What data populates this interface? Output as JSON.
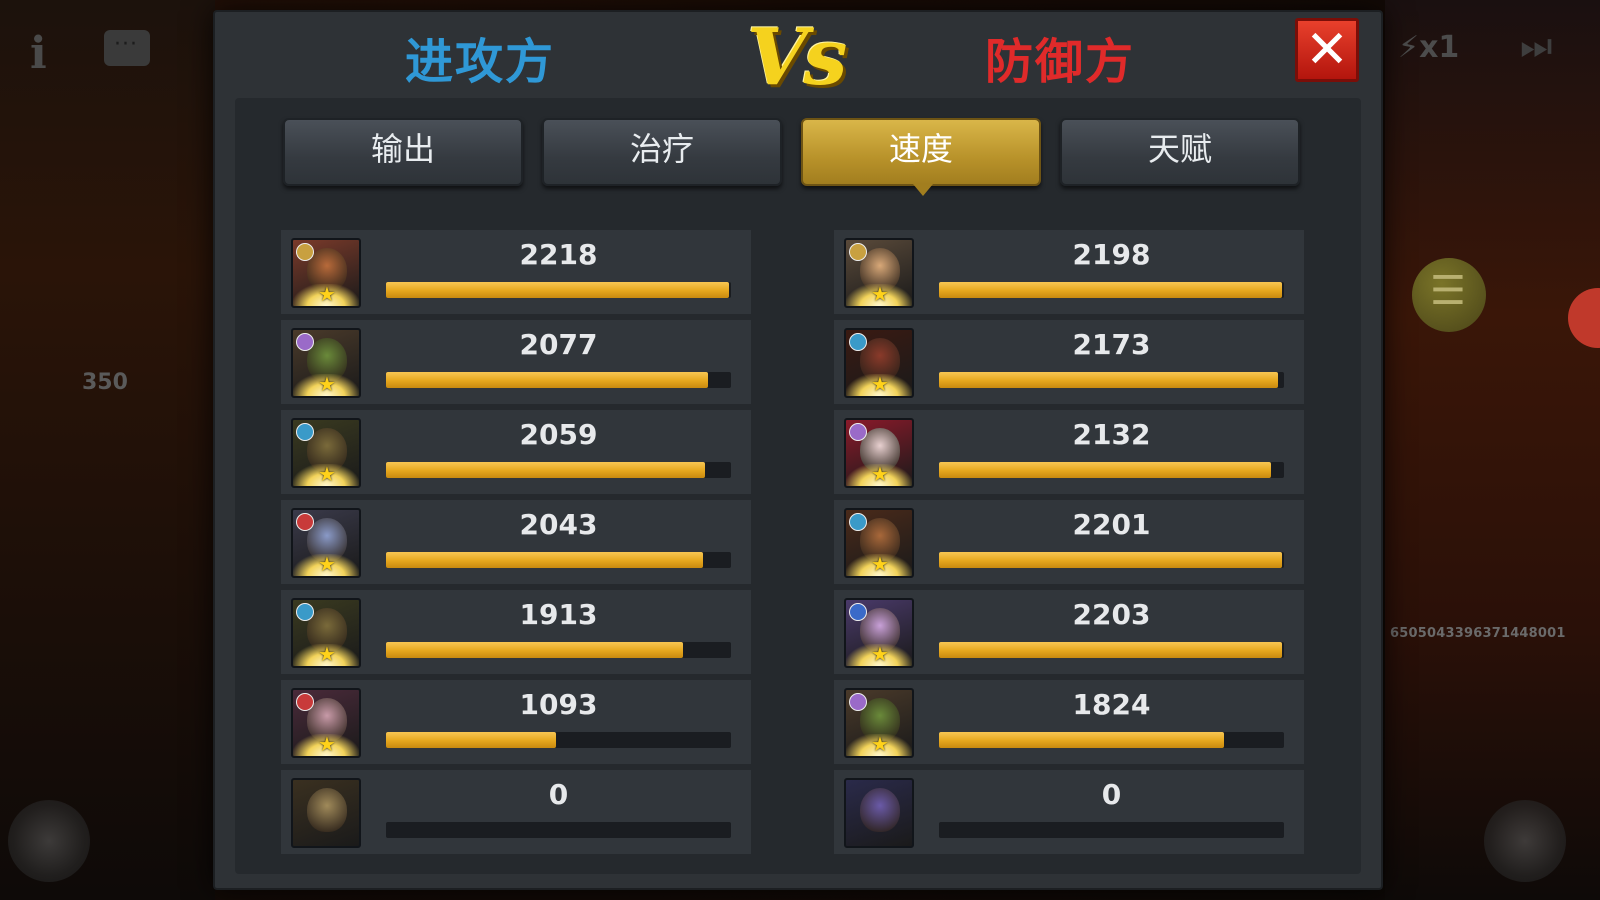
{
  "hud": {
    "info_icon": "i",
    "left_number": "350",
    "speed_label": "x1",
    "id_text": "6505043396371448001"
  },
  "header": {
    "attacker_title": "进攻方",
    "vs_label": "Vs",
    "defender_title": "防御方",
    "close_icon": "✕"
  },
  "tabs": [
    {
      "label": "输出",
      "active": false
    },
    {
      "label": "治疗",
      "active": false
    },
    {
      "label": "速度",
      "active": true
    },
    {
      "label": "天赋",
      "active": false
    }
  ],
  "colors": {
    "attacker": "#2f98d6",
    "defender": "#e02a2a",
    "bar_fill": "#e6a71d",
    "active_tab": "#b8922a"
  },
  "attackers": [
    {
      "value": "2218",
      "fraction": 1.0,
      "badge_color": "#c8a040",
      "face_color": "#b86a3a",
      "frame": "#7a3a2a"
    },
    {
      "value": "2077",
      "fraction": 0.94,
      "badge_color": "#9a6ac8",
      "face_color": "#6a8a3a",
      "frame": "#4a3a2a"
    },
    {
      "value": "2059",
      "fraction": 0.93,
      "badge_color": "#3a9ac8",
      "face_color": "#7a6a3a",
      "frame": "#3a3a20"
    },
    {
      "value": "2043",
      "fraction": 0.925,
      "badge_color": "#c83a3a",
      "face_color": "#8a9ac8",
      "frame": "#3a3a4a"
    },
    {
      "value": "1913",
      "fraction": 0.865,
      "badge_color": "#3a9ac8",
      "face_color": "#7a6a3a",
      "frame": "#3a3a20"
    },
    {
      "value": "1093",
      "fraction": 0.495,
      "badge_color": "#c83a3a",
      "face_color": "#c89aa8",
      "frame": "#4a2a3a"
    },
    {
      "value": "0",
      "fraction": 0.0,
      "badge_color": "",
      "face_color": "#a08a5a",
      "frame": "#3a3020"
    }
  ],
  "defenders": [
    {
      "value": "2198",
      "fraction": 1.0,
      "badge_color": "#c8a040",
      "face_color": "#d8a878",
      "frame": "#5a4a3a"
    },
    {
      "value": "2173",
      "fraction": 0.988,
      "badge_color": "#3a9ac8",
      "face_color": "#8a3a2a",
      "frame": "#3a1a12"
    },
    {
      "value": "2132",
      "fraction": 0.969,
      "badge_color": "#9a6ac8",
      "face_color": "#e8d0d0",
      "frame": "#8a1a2a"
    },
    {
      "value": "2201",
      "fraction": 1.0,
      "badge_color": "#3a9ac8",
      "face_color": "#a8683a",
      "frame": "#4a2a1a"
    },
    {
      "value": "2203",
      "fraction": 1.0,
      "badge_color": "#3a6ac8",
      "face_color": "#c8a0d8",
      "frame": "#4a3a6a"
    },
    {
      "value": "1824",
      "fraction": 0.83,
      "badge_color": "#9a6ac8",
      "face_color": "#6a8a3a",
      "frame": "#4a3a2a"
    },
    {
      "value": "0",
      "fraction": 0.0,
      "badge_color": "",
      "face_color": "#6a5aa8",
      "frame": "#2a2a4a"
    }
  ]
}
